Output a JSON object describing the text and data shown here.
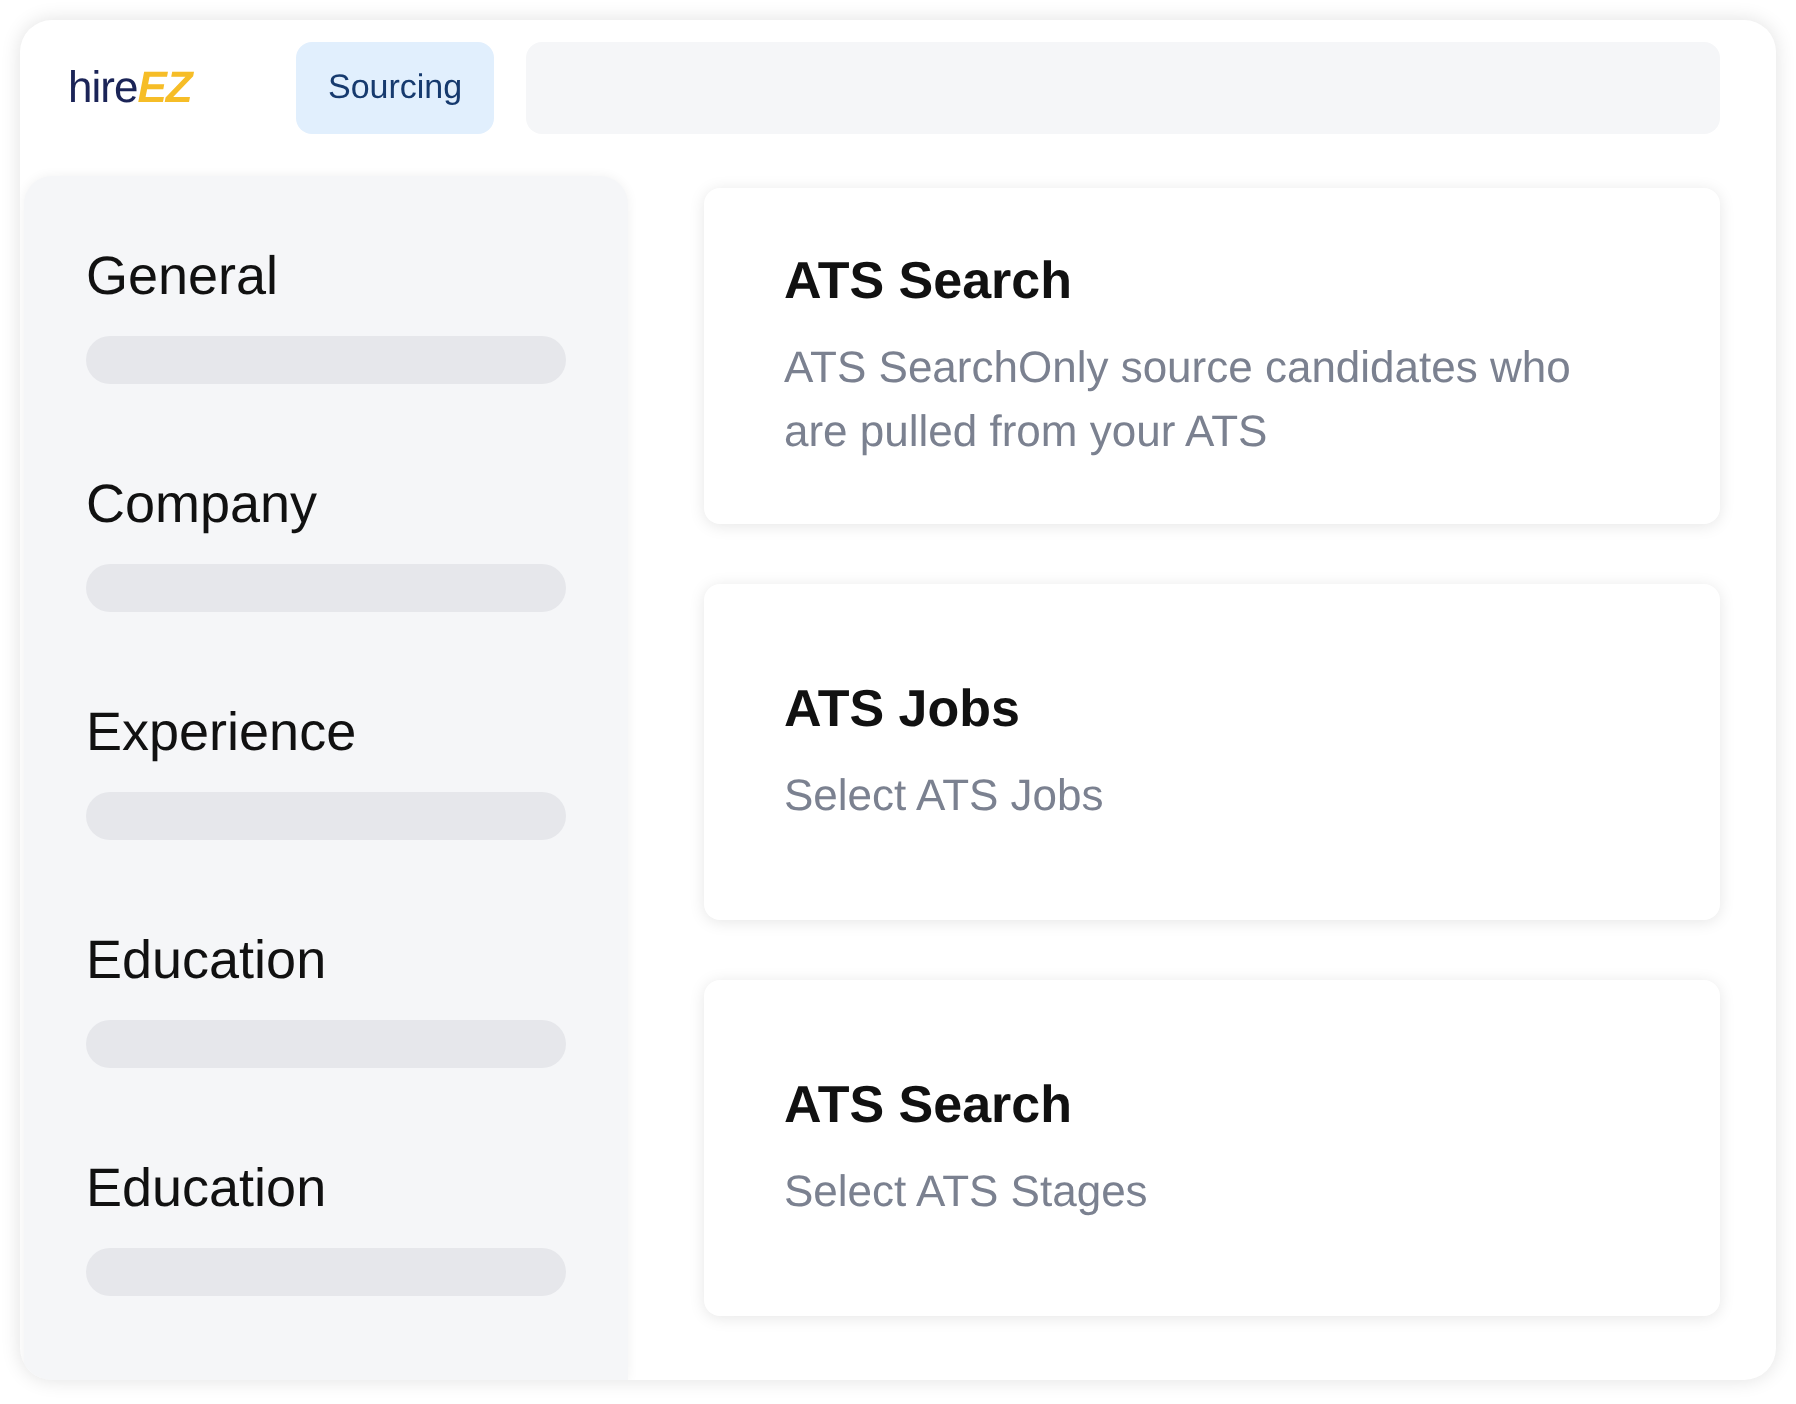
{
  "header": {
    "logo": {
      "text": "hire",
      "accent": "EZ"
    },
    "tab": {
      "label": "Sourcing",
      "selected": true
    }
  },
  "sidebar": {
    "sections": [
      {
        "label": "General"
      },
      {
        "label": "Company"
      },
      {
        "label": "Experience"
      },
      {
        "label": "Education"
      },
      {
        "label": "Education"
      }
    ]
  },
  "cards": [
    {
      "title": "ATS Search",
      "description": "ATS SearchOnly source candidates who are pulled from your ATS"
    },
    {
      "title": "ATS Jobs",
      "description": "Select ATS Jobs"
    },
    {
      "title": "ATS Search",
      "description": "Select ATS Stages"
    }
  ]
}
